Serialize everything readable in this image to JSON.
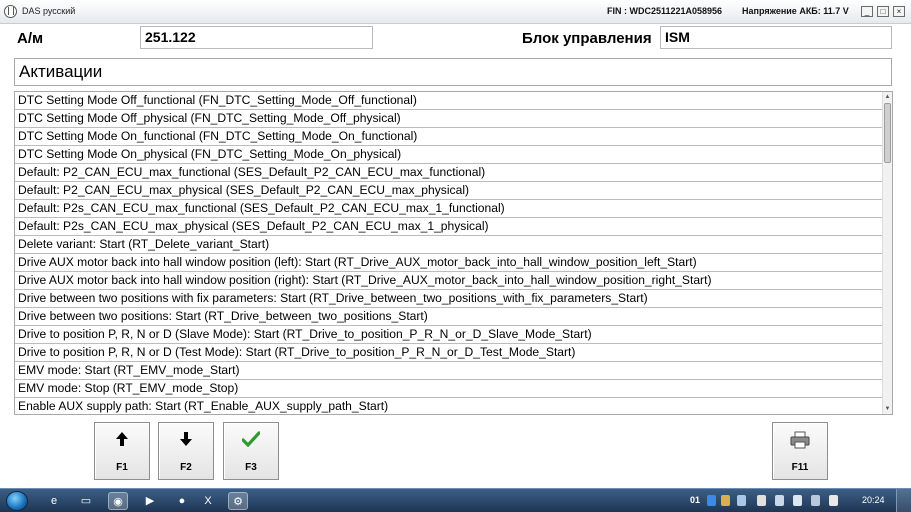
{
  "window": {
    "title": "DAS русский",
    "fin": "FIN : WDC2511221A058956",
    "battery": "Напряжение АКБ: 11.7 V",
    "controls": {
      "minimize": "_",
      "maximize": "□",
      "close": "×"
    }
  },
  "header": {
    "am_label": "А/м",
    "am_value": "251.122",
    "block_label": "Блок управления",
    "block_value": "ISM"
  },
  "section_title": "Активации",
  "list": {
    "items": [
      "DTC Setting Mode Off_functional (FN_DTC_Setting_Mode_Off_functional)",
      "DTC Setting Mode Off_physical (FN_DTC_Setting_Mode_Off_physical)",
      "DTC Setting Mode On_functional (FN_DTC_Setting_Mode_On_functional)",
      "DTC Setting Mode On_physical (FN_DTC_Setting_Mode_On_physical)",
      "Default: P2_CAN_ECU_max_functional (SES_Default_P2_CAN_ECU_max_functional)",
      "Default: P2_CAN_ECU_max_physical (SES_Default_P2_CAN_ECU_max_physical)",
      "Default: P2s_CAN_ECU_max_functional (SES_Default_P2_CAN_ECU_max_1_functional)",
      "Default: P2s_CAN_ECU_max_physical (SES_Default_P2_CAN_ECU_max_1_physical)",
      "Delete variant: Start (RT_Delete_variant_Start)",
      "Drive AUX motor back into hall window position (left): Start (RT_Drive_AUX_motor_back_into_hall_window_position_left_Start)",
      "Drive AUX motor back into hall window position (right): Start (RT_Drive_AUX_motor_back_into_hall_window_position_right_Start)",
      "Drive between two positions with fix parameters: Start (RT_Drive_between_two_positions_with_fix_parameters_Start)",
      "Drive between two positions: Start (RT_Drive_between_two_positions_Start)",
      "Drive to position P, R, N or D (Slave Mode): Start (RT_Drive_to_position_P_R_N_or_D_Slave_Mode_Start)",
      "Drive to position P, R, N or D (Test Mode): Start (RT_Drive_to_position_P_R_N_or_D_Test_Mode_Start)",
      "EMV mode: Start (RT_EMV_mode_Start)",
      "EMV mode: Stop (RT_EMV_mode_Stop)",
      "Enable AUX supply path: Start (RT_Enable_AUX_supply_path_Start)"
    ],
    "scroll_up_icon": "arrow-up-icon",
    "scroll_down_icon": "arrow-down-icon"
  },
  "function_keys": [
    {
      "label": "F1",
      "icon": "arrow-up-icon",
      "color": "#000000"
    },
    {
      "label": "F2",
      "icon": "arrow-down-icon",
      "color": "#000000"
    },
    {
      "label": "F3",
      "icon": "checkmark-icon",
      "color": "#2f9a2f"
    },
    {
      "label": "F11",
      "icon": "printer-icon",
      "color": "#555555"
    }
  ],
  "taskbar": {
    "language": "01",
    "clock": "20:24"
  }
}
